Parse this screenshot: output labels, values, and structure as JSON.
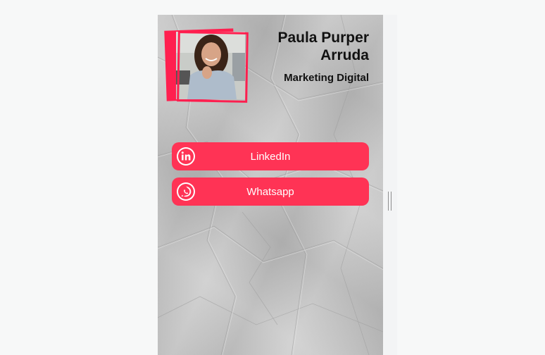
{
  "profile": {
    "name": "Paula Purper Arruda",
    "role": "Marketing Digital"
  },
  "buttons": [
    {
      "label": "LinkedIn",
      "icon": "linkedin-icon"
    },
    {
      "label": "Whatsapp",
      "icon": "whatsapp-icon"
    }
  ],
  "colors": {
    "accent": "#ff3355",
    "frame": "#ff1f4f",
    "card_bg": "#c6c6c6",
    "page_bg": "#f7f8f8"
  }
}
